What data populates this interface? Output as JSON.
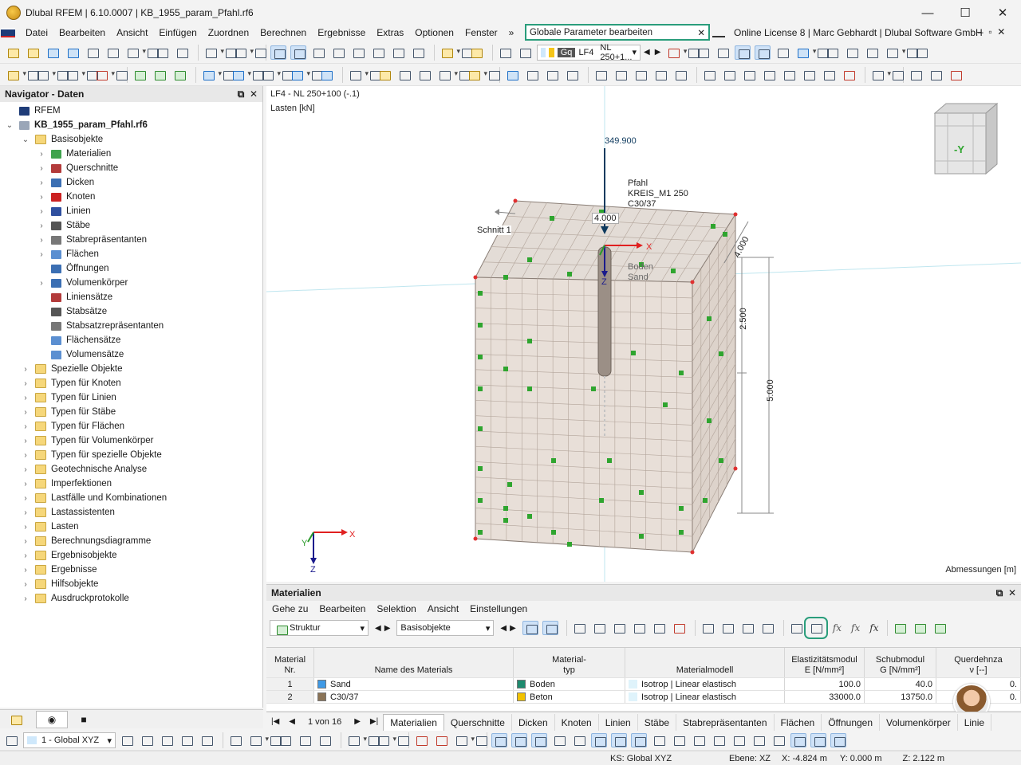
{
  "window": {
    "title": "Dlubal RFEM | 6.10.0007 | KB_1955_param_Pfahl.rf6",
    "min": "—",
    "max": "☐",
    "close": "✕"
  },
  "menu": [
    "Datei",
    "Bearbeiten",
    "Ansicht",
    "Einfügen",
    "Zuordnen",
    "Berechnen",
    "Ergebnisse",
    "Extras",
    "Optionen",
    "Fenster"
  ],
  "menu_more": "»",
  "search": {
    "value": "Globale Parameter bearbeiten",
    "clear": "✕"
  },
  "license": "Online License 8 | Marc Gebhardt | Dlubal Software GmbH",
  "toolbar": {
    "lc_code": "Gq",
    "lc_id": "LF4",
    "lc_name": "NL 250+1...",
    "lc_color": "#f5c518"
  },
  "navigator": {
    "title": "Navigator - Daten",
    "root": "RFEM",
    "file": "KB_1955_param_Pfahl.rf6",
    "basis": "Basisobjekte",
    "basis_items": [
      "Materialien",
      "Querschnitte",
      "Dicken",
      "Knoten",
      "Linien",
      "Stäbe",
      "Stabrepräsentanten",
      "Flächen",
      "Öffnungen",
      "Volumenkörper",
      "Liniensätze",
      "Stabsätze",
      "Stabsatzrepräsentanten",
      "Flächensätze",
      "Volumensätze"
    ],
    "folders": [
      "Spezielle Objekte",
      "Typen für Knoten",
      "Typen für Linien",
      "Typen für Stäbe",
      "Typen für Flächen",
      "Typen für Volumenkörper",
      "Typen für spezielle Objekte",
      "Geotechnische Analyse",
      "Imperfektionen",
      "Lastfälle und Kombinationen",
      "Lastassistenten",
      "Lasten",
      "Berechnungsdiagramme",
      "Ergebnisobjekte",
      "Ergebnisse",
      "Hilfsobjekte",
      "Ausdruckprotokolle"
    ]
  },
  "view": {
    "load_title": "LF4 - NL 250+100 (-.1)",
    "load_unit": "Lasten [kN]",
    "load_value": "349.900",
    "pile_label": "Pfahl",
    "pile_section": "KREIS_M1 250",
    "pile_material": "C30/37",
    "soil_label": "Boden",
    "soil_material": "Sand",
    "section_label": "Schnitt 1",
    "dim_top": "4.000",
    "dim_right": "4.000",
    "dim_mid": "2.500",
    "dim_height": "5.000",
    "dims_caption": "Abmessungen [m]",
    "axis_x": "X",
    "axis_y": "Y",
    "axis_z": "Z",
    "cube_face": "-Y"
  },
  "materials": {
    "title": "Materialien",
    "menu": [
      "Gehe zu",
      "Bearbeiten",
      "Selektion",
      "Ansicht",
      "Einstellungen"
    ],
    "combo_struct": "Struktur",
    "combo_basis": "Basisobjekte",
    "columns": [
      {
        "l1": "Material",
        "l2": "Nr."
      },
      {
        "l1": "",
        "l2": "Name des Materials"
      },
      {
        "l1": "Material-",
        "l2": "typ"
      },
      {
        "l1": "",
        "l2": "Materialmodell"
      },
      {
        "l1": "Elastizitätsmodul",
        "l2": "E [N/mm²]"
      },
      {
        "l1": "Schubmodul",
        "l2": "G [N/mm²]"
      },
      {
        "l1": "Querdehnza",
        "l2": "ν [--]"
      }
    ],
    "rows": [
      {
        "nr": "1",
        "name": "Sand",
        "name_color": "#3f9ae6",
        "typ": "Boden",
        "typ_color": "#1e8a6e",
        "model": "Isotrop | Linear elastisch",
        "E": "100.0",
        "G": "40.0",
        "nu": "0."
      },
      {
        "nr": "2",
        "name": "C30/37",
        "name_color": "#8a7356",
        "typ": "Beton",
        "typ_color": "#f2c200",
        "model": "Isotrop | Linear elastisch",
        "E": "33000.0",
        "G": "13750.0",
        "nu": "0."
      }
    ],
    "pager": "1 von 16",
    "tabs": [
      "Materialien",
      "Querschnitte",
      "Dicken",
      "Knoten",
      "Linien",
      "Stäbe",
      "Stabrepräsentanten",
      "Flächen",
      "Öffnungen",
      "Volumenkörper",
      "Linie"
    ]
  },
  "status": {
    "coord_sys": "1 - Global XYZ",
    "ks": "KS: Global XYZ",
    "ebene": "Ebene: XZ",
    "x": "X: -4.824 m",
    "y": "Y: 0.000 m",
    "z": "Z: 2.122 m"
  }
}
